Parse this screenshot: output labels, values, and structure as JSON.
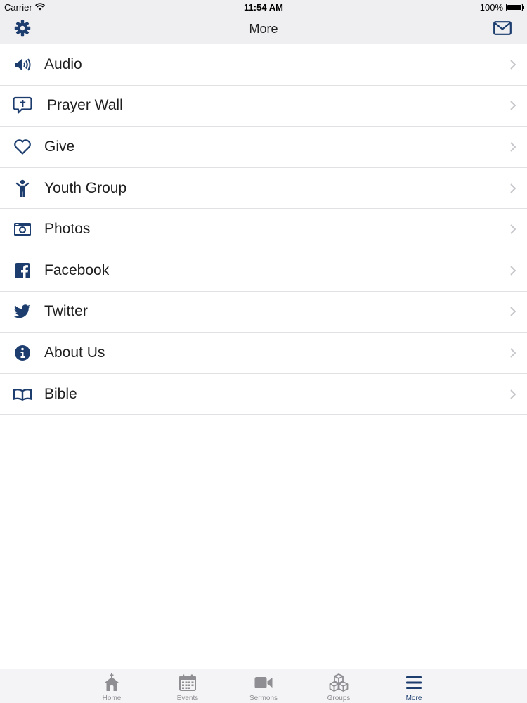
{
  "status_bar": {
    "carrier": "Carrier",
    "time": "11:54 AM",
    "battery": "100%",
    "battery_level": 1.0
  },
  "nav": {
    "title": "More",
    "left_icon": "gear-icon",
    "right_icon": "envelope-icon"
  },
  "menu": {
    "items": [
      {
        "label": "Audio",
        "icon": "speaker-icon"
      },
      {
        "label": "Prayer Wall",
        "icon": "speech-cross-icon"
      },
      {
        "label": "Give",
        "icon": "heart-icon"
      },
      {
        "label": "Youth Group",
        "icon": "person-icon"
      },
      {
        "label": "Photos",
        "icon": "camera-icon"
      },
      {
        "label": "Facebook",
        "icon": "facebook-icon"
      },
      {
        "label": "Twitter",
        "icon": "twitter-icon"
      },
      {
        "label": "About Us",
        "icon": "info-icon"
      },
      {
        "label": "Bible",
        "icon": "book-icon"
      }
    ]
  },
  "tabs": [
    {
      "label": "Home",
      "icon": "church-icon",
      "active": false
    },
    {
      "label": "Events",
      "icon": "calendar-icon",
      "active": false
    },
    {
      "label": "Sermons",
      "icon": "video-camera-icon",
      "active": false
    },
    {
      "label": "Groups",
      "icon": "cubes-icon",
      "active": false
    },
    {
      "label": "More",
      "icon": "menu-icon",
      "active": true
    }
  ],
  "colors": {
    "accent": "#1c3d6e",
    "inactive": "#8e8e93",
    "chevron": "#c7c7cc"
  }
}
